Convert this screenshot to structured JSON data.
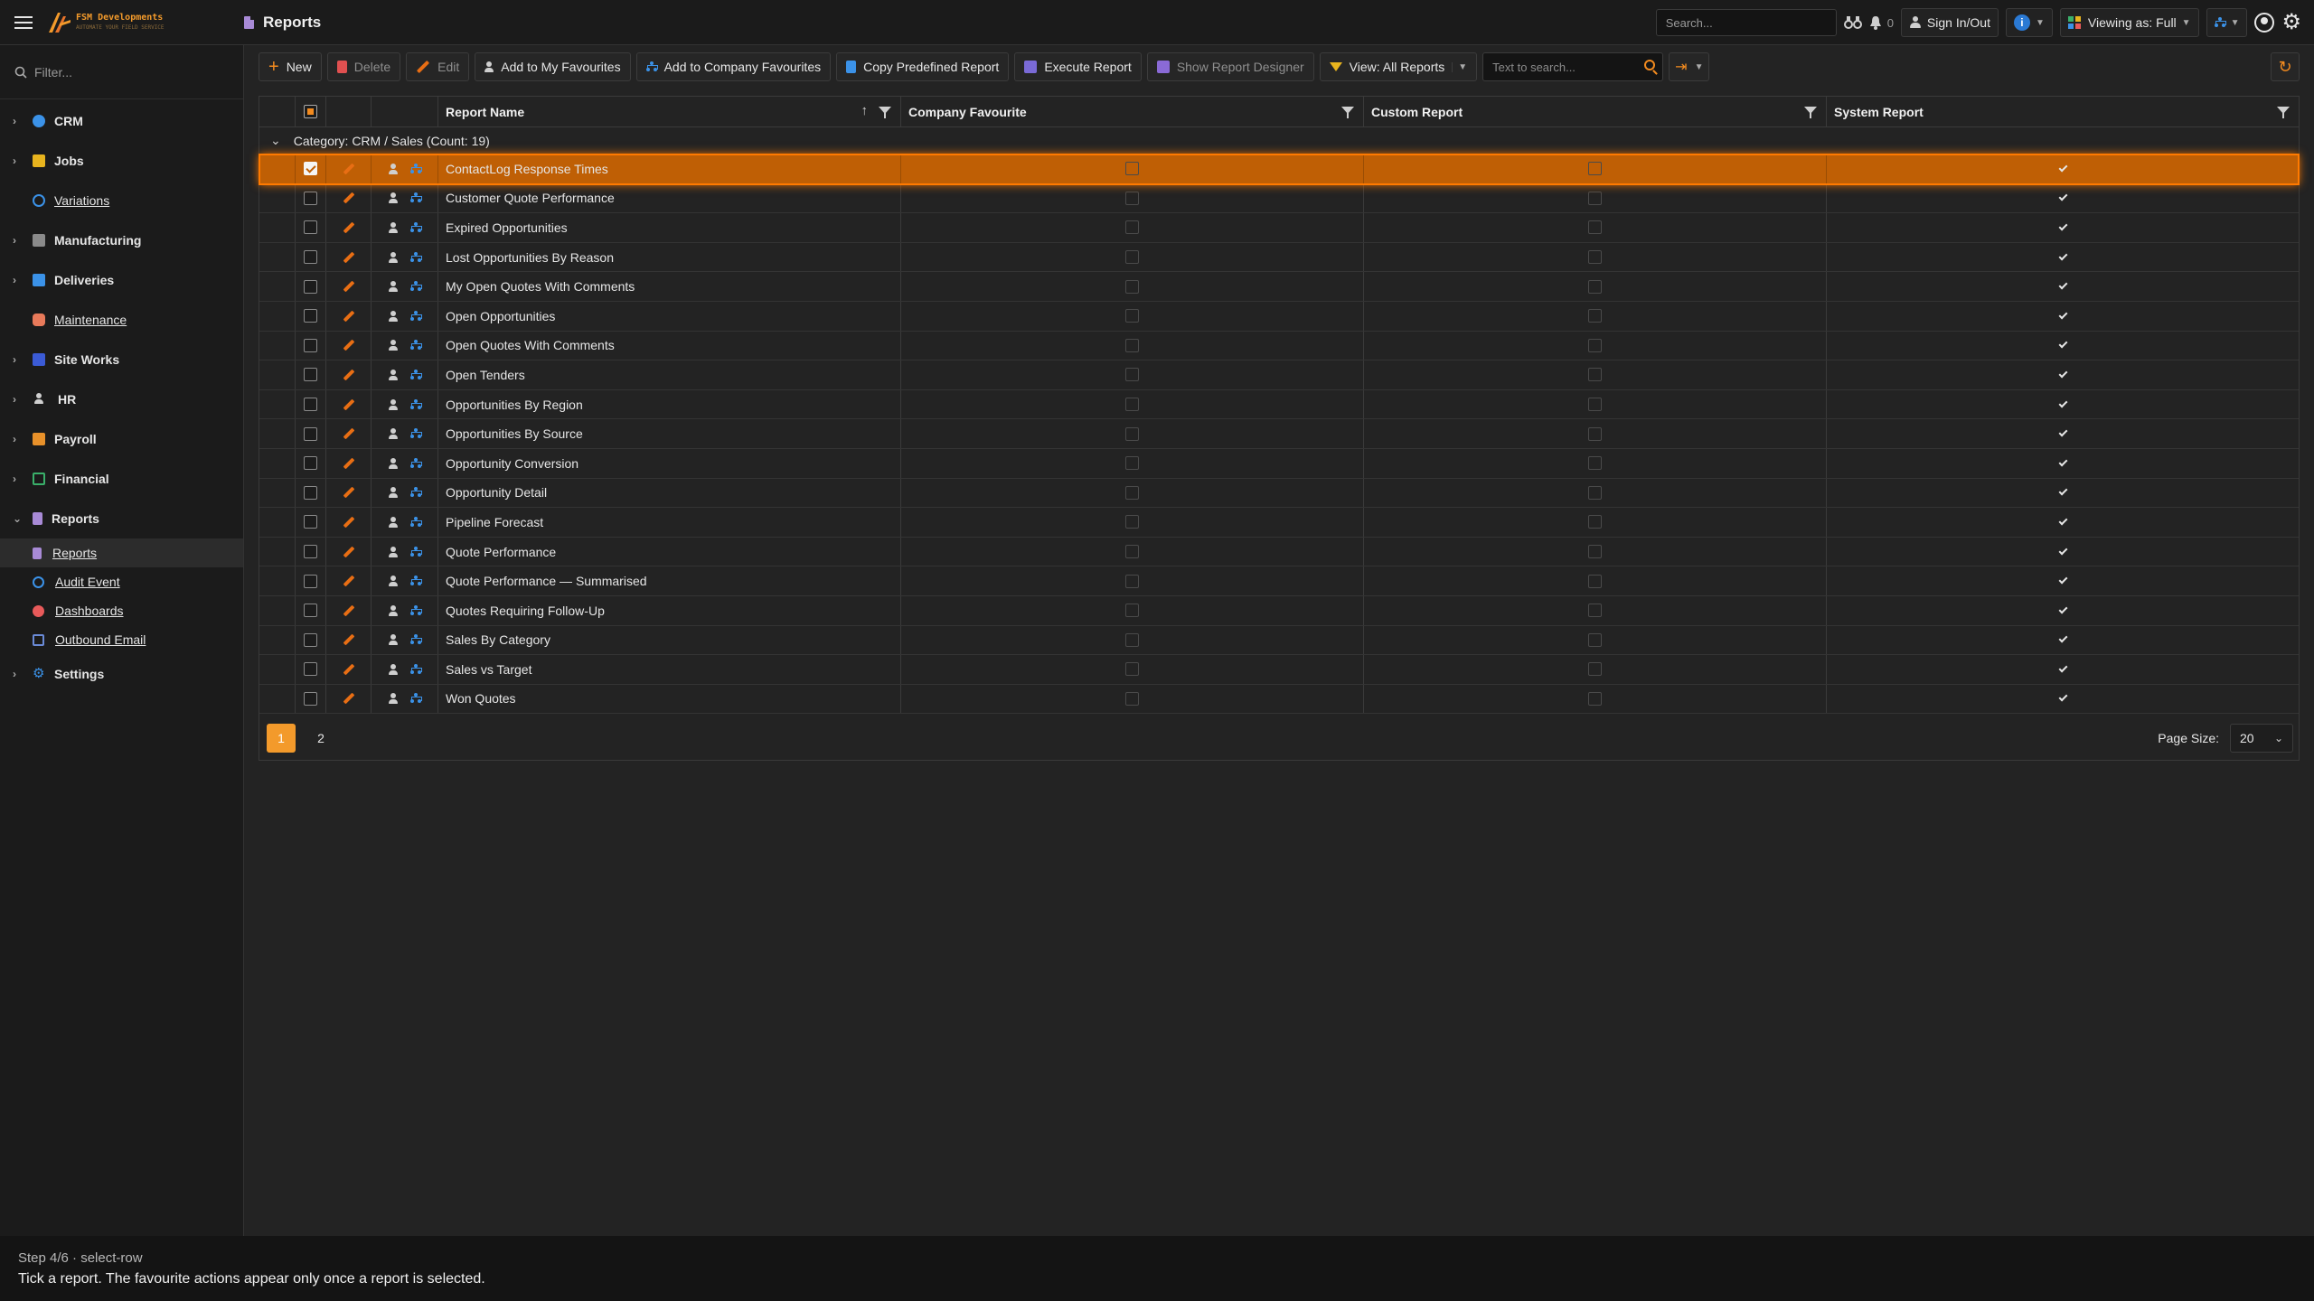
{
  "brand": {
    "name": "FSM Developments",
    "tagline": "AUTOMATE YOUR FIELD SERVICE"
  },
  "header": {
    "title": "Reports",
    "search_placeholder": "Search...",
    "notifications_count": "0",
    "sign_in_label": "Sign In/Out",
    "info_label": "i",
    "viewing_label": "Viewing as: Full"
  },
  "sidebar": {
    "filter_placeholder": "Filter...",
    "items": [
      {
        "label": "CRM",
        "icon": "person-icon",
        "color": "#3b92e8",
        "expandable": true
      },
      {
        "label": "Jobs",
        "icon": "jobs-icon",
        "color": "#e8b41e",
        "expandable": true
      },
      {
        "label": "Variations",
        "icon": "variations-icon",
        "color": "#3b92e8",
        "expandable": false
      },
      {
        "label": "Manufacturing",
        "icon": "factory-icon",
        "color": "#8a8a8a",
        "expandable": true
      },
      {
        "label": "Deliveries",
        "icon": "truck-icon",
        "color": "#3b92e8",
        "expandable": true
      },
      {
        "label": "Maintenance",
        "icon": "maintenance-icon",
        "color": "#e87a5a",
        "expandable": false
      },
      {
        "label": "Site Works",
        "icon": "site-works-icon",
        "color": "#3b5bd6",
        "expandable": true
      },
      {
        "label": "HR",
        "icon": "hr-icon",
        "color": "#cfcfcf",
        "expandable": true
      },
      {
        "label": "Payroll",
        "icon": "folder-icon",
        "color": "#e8912a",
        "expandable": true
      },
      {
        "label": "Financial",
        "icon": "ledger-icon",
        "color": "#3ab06a",
        "expandable": true
      },
      {
        "label": "Reports",
        "icon": "reports-icon",
        "color": "#a88ad6",
        "expandable": true,
        "expanded": true
      }
    ],
    "report_children": [
      {
        "label": "Reports",
        "icon": "reports-icon",
        "color": "#a88ad6",
        "active": true
      },
      {
        "label": "Audit Event",
        "icon": "audit-icon",
        "color": "#3b92e8",
        "active": false
      },
      {
        "label": "Dashboards",
        "icon": "dashboard-icon",
        "color": "#e85a5a",
        "active": false
      },
      {
        "label": "Outbound Email",
        "icon": "email-icon",
        "color": "#6a8ad6",
        "active": false
      }
    ],
    "settings_label": "Settings"
  },
  "toolbar": {
    "new_label": "New",
    "delete_label": "Delete",
    "edit_label": "Edit",
    "add_my_fav_label": "Add to My Favourites",
    "add_company_fav_label": "Add to Company Favourites",
    "copy_label": "Copy Predefined Report",
    "execute_label": "Execute Report",
    "designer_label": "Show Report Designer",
    "view_label": "View: All Reports",
    "search_placeholder": "Text to search..."
  },
  "grid": {
    "columns": {
      "name": "Report Name",
      "company_favourite": "Company Favourite",
      "custom_report": "Custom Report",
      "system_report": "System Report"
    },
    "group_label": "Category: CRM / Sales (Count: 19)",
    "rows": [
      {
        "name": "ContactLog Response Times",
        "selected": true
      },
      {
        "name": "Customer Quote Performance",
        "selected": false
      },
      {
        "name": "Expired Opportunities",
        "selected": false
      },
      {
        "name": "Lost Opportunities By Reason",
        "selected": false
      },
      {
        "name": "My Open Quotes With Comments",
        "selected": false
      },
      {
        "name": "Open Opportunities",
        "selected": false
      },
      {
        "name": "Open Quotes With Comments",
        "selected": false
      },
      {
        "name": "Open Tenders",
        "selected": false
      },
      {
        "name": "Opportunities By Region",
        "selected": false
      },
      {
        "name": "Opportunities By Source",
        "selected": false
      },
      {
        "name": "Opportunity Conversion",
        "selected": false
      },
      {
        "name": "Opportunity Detail",
        "selected": false
      },
      {
        "name": "Pipeline Forecast",
        "selected": false
      },
      {
        "name": "Quote Performance",
        "selected": false
      },
      {
        "name": "Quote Performance — Summarised",
        "selected": false
      },
      {
        "name": "Quotes Requiring Follow-Up",
        "selected": false
      },
      {
        "name": "Sales By Category",
        "selected": false
      },
      {
        "name": "Sales vs Target",
        "selected": false
      },
      {
        "name": "Won Quotes",
        "selected": false
      }
    ],
    "pages": [
      "1",
      "2"
    ],
    "current_page": "1",
    "page_size_label": "Page Size:",
    "page_size": "20"
  },
  "hint": {
    "step": "Step 4/6 · select-row",
    "text": "Tick a report. The favourite actions appear only once a report is selected."
  }
}
